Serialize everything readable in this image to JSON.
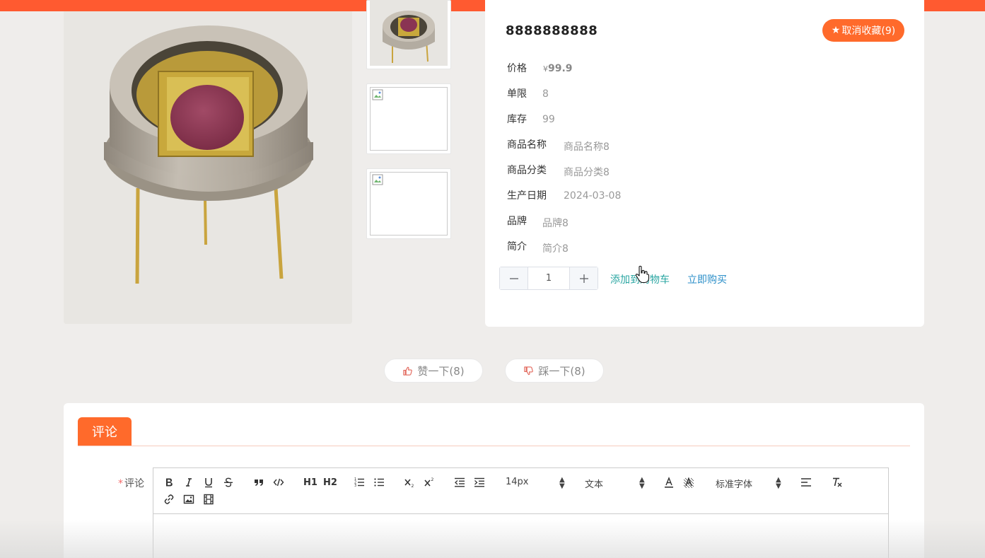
{
  "product": {
    "title": "8888888888",
    "favorite_label": "取消收藏(9)",
    "fields": {
      "price_label": "价格",
      "price_currency": "¥",
      "price_value": "99.9",
      "limit_label": "单限",
      "limit_value": "8",
      "stock_label": "库存",
      "stock_value": "99",
      "name_label": "商品名称",
      "name_value": "商品名称8",
      "category_label": "商品分类",
      "category_value": "商品分类8",
      "date_label": "生产日期",
      "date_value": "2024-03-08",
      "brand_label": "品牌",
      "brand_value": "品牌8",
      "intro_label": "简介",
      "intro_value": "简介8"
    },
    "quantity": "1",
    "add_to_cart_label": "添加到购物车",
    "buy_now_label": "立即购买"
  },
  "votes": {
    "like_label": "赞一下(8)",
    "dislike_label": "踩一下(8)"
  },
  "comments": {
    "tab_label": "评论",
    "field_required_mark": "*",
    "field_label": "评论",
    "toolbar": {
      "h1": "H1",
      "h2": "H2",
      "font_size": "14px",
      "heading": "文本",
      "font_family": "标准字体"
    }
  },
  "colors": {
    "accent": "#ff6a2b",
    "topbar": "#ff5a30",
    "link_cart": "#2aa6a2",
    "link_buy": "#2a8ec8"
  }
}
